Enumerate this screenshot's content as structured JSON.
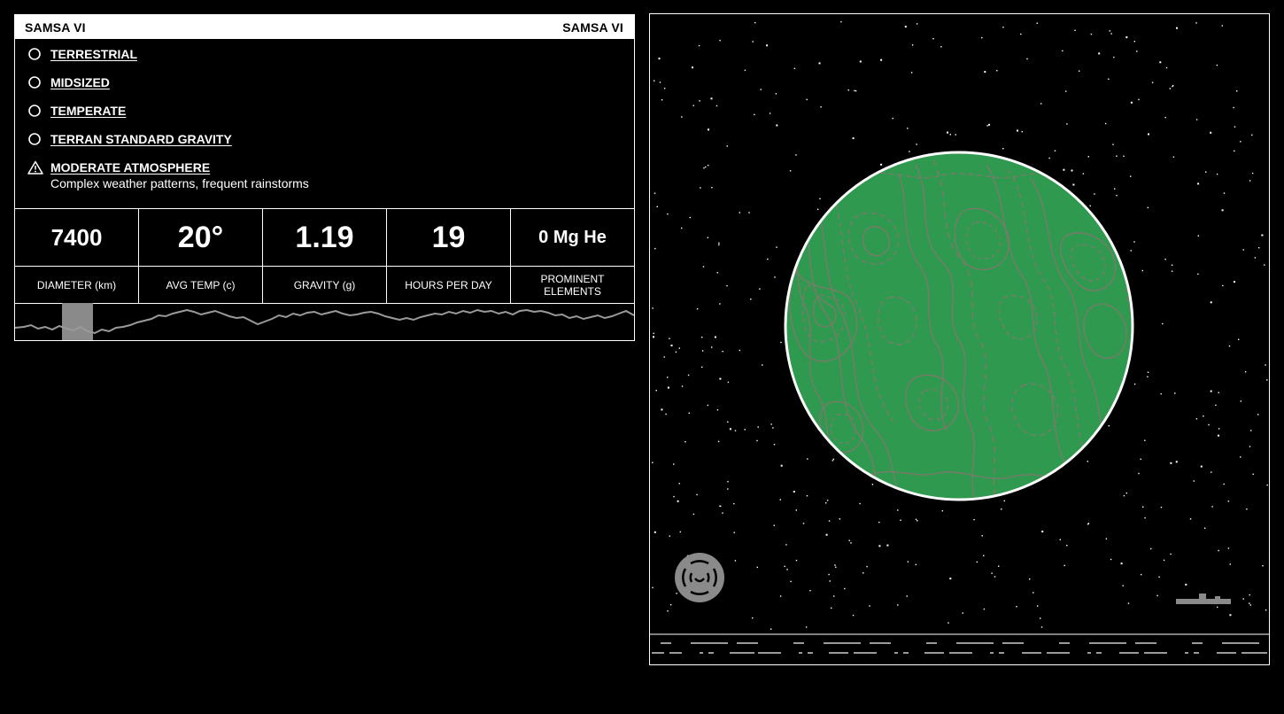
{
  "header": {
    "name_left": "SAMSA VI",
    "name_right": "SAMSA VI"
  },
  "traits": [
    {
      "label": "TERRESTRIAL",
      "icon": "circle-icon",
      "description": ""
    },
    {
      "label": "MIDSIZED",
      "icon": "circle-icon",
      "description": ""
    },
    {
      "label": "TEMPERATE",
      "icon": "circle-icon",
      "description": ""
    },
    {
      "label": "TERRAN STANDARD GRAVITY",
      "icon": "circle-icon",
      "description": ""
    },
    {
      "label": "MODERATE ATMOSPHERE",
      "icon": "warning-triangle-icon",
      "description": "Complex weather patterns, frequent rainstorms"
    }
  ],
  "stats": [
    {
      "value": "7400",
      "label": "DIAMETER (km)"
    },
    {
      "value": "20°",
      "label": "AVG TEMP (c)"
    },
    {
      "value": "1.19",
      "label": "GRAVITY (g)"
    },
    {
      "value": "19",
      "label": "HOURS PER DAY"
    },
    {
      "value": "0 Mg He",
      "label": "PROMINENT ELEMENTS"
    }
  ],
  "planet": {
    "surface_color": "#2f9a4f",
    "contour_color": "#7a7a6a",
    "outline_color": "#ffffff"
  },
  "icons": {
    "radar": "radar-icon",
    "ship": "ship-icon"
  }
}
